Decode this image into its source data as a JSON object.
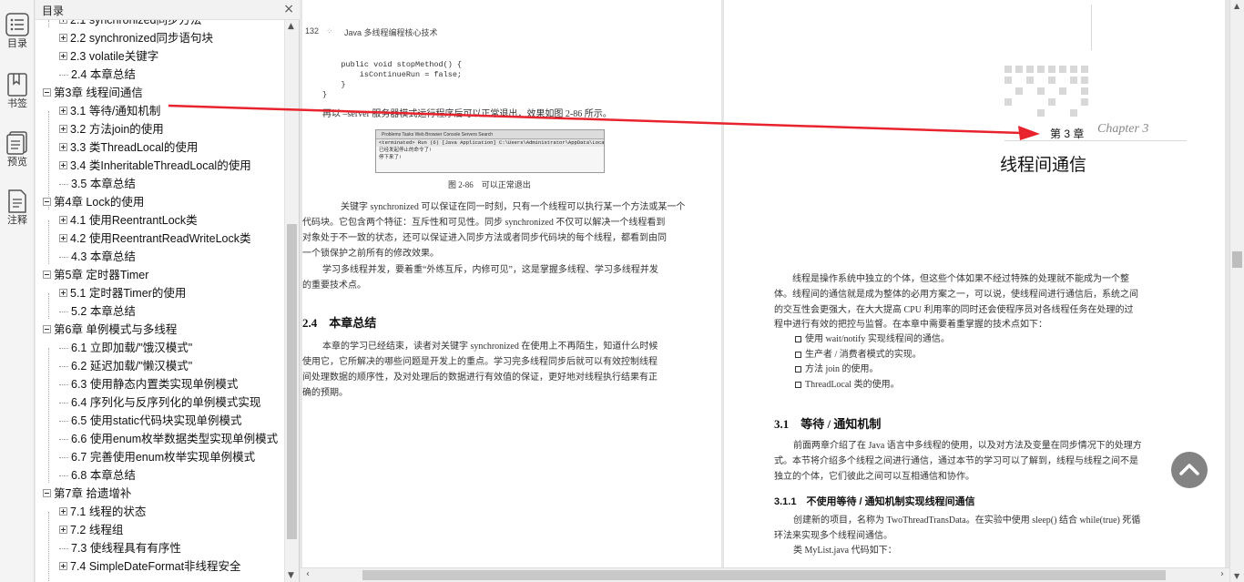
{
  "rail": {
    "items": [
      {
        "label": "目录",
        "icon": "toc-icon"
      },
      {
        "label": "书签",
        "icon": "bookmark-icon"
      },
      {
        "label": "预览",
        "icon": "preview-icon"
      },
      {
        "label": "注释",
        "icon": "annotation-icon"
      }
    ]
  },
  "toc": {
    "title": "目录",
    "close": "×",
    "items": [
      {
        "label": "2.1 synchronized同步方法",
        "level": 2,
        "expand": "plus"
      },
      {
        "label": "2.2 synchronized同步语句块",
        "level": 2,
        "expand": "plus"
      },
      {
        "label": "2.3 volatile关键字",
        "level": 2,
        "expand": "plus"
      },
      {
        "label": "2.4 本章总结",
        "level": 2,
        "expand": "none"
      },
      {
        "label": "第3章 线程间通信",
        "level": 1,
        "expand": "minus"
      },
      {
        "label": "3.1 等待/通知机制",
        "level": 2,
        "expand": "plus"
      },
      {
        "label": "3.2 方法join的使用",
        "level": 2,
        "expand": "plus"
      },
      {
        "label": "3.3 类ThreadLocal的使用",
        "level": 2,
        "expand": "plus"
      },
      {
        "label": "3.4 类InheritableThreadLocal的使用",
        "level": 2,
        "expand": "plus"
      },
      {
        "label": "3.5 本章总结",
        "level": 2,
        "expand": "none"
      },
      {
        "label": "第4章 Lock的使用",
        "level": 1,
        "expand": "minus"
      },
      {
        "label": "4.1 使用ReentrantLock类",
        "level": 2,
        "expand": "plus"
      },
      {
        "label": "4.2 使用ReentrantReadWriteLock类",
        "level": 2,
        "expand": "plus"
      },
      {
        "label": "4.3 本章总结",
        "level": 2,
        "expand": "none"
      },
      {
        "label": "第5章 定时器Timer",
        "level": 1,
        "expand": "minus"
      },
      {
        "label": "5.1 定时器Timer的使用",
        "level": 2,
        "expand": "plus"
      },
      {
        "label": "5.2 本章总结",
        "level": 2,
        "expand": "none"
      },
      {
        "label": "第6章 单例模式与多线程",
        "level": 1,
        "expand": "minus"
      },
      {
        "label": "6.1 立即加载/\"饿汉模式\"",
        "level": 2,
        "expand": "none"
      },
      {
        "label": "6.2 延迟加载/\"懒汉模式\"",
        "level": 2,
        "expand": "none"
      },
      {
        "label": "6.3 使用静态内置类实现单例模式",
        "level": 2,
        "expand": "none"
      },
      {
        "label": "6.4 序列化与反序列化的单例模式实现",
        "level": 2,
        "expand": "none"
      },
      {
        "label": "6.5 使用static代码块实现单例模式",
        "level": 2,
        "expand": "none"
      },
      {
        "label": "6.6 使用enum枚举数据类型实现单例模式",
        "level": 2,
        "expand": "none"
      },
      {
        "label": "6.7 完善使用enum枚举实现单例模式",
        "level": 2,
        "expand": "none"
      },
      {
        "label": "6.8 本章总结",
        "level": 2,
        "expand": "none"
      },
      {
        "label": "第7章 拾遗增补",
        "level": 1,
        "expand": "minus"
      },
      {
        "label": "7.1 线程的状态",
        "level": 2,
        "expand": "plus"
      },
      {
        "label": "7.2 线程组",
        "level": 2,
        "expand": "plus"
      },
      {
        "label": "7.3 使线程具有有序性",
        "level": 2,
        "expand": "none"
      },
      {
        "label": "7.4 SimpleDateFormat非线程安全",
        "level": 2,
        "expand": "plus"
      }
    ]
  },
  "left_page": {
    "header_num": "132",
    "header_title": "Java 多线程编程核心技术",
    "code": "    public void stopMethod() {\n        isContinueRun = false;\n    }\n}",
    "para1": "再以 –server 服务器模式运行程序后可以正常退出，效果如图 2-86 所示。",
    "shot_tabs": "Problems  Tasks  Web Browser  Console  Servers  Search",
    "shot_line1": "<terminated> Run (6) [Java Application] C:\\Users\\Administrator\\AppData\\Local\\",
    "shot_line2": "已经发起停止的命令了!",
    "shot_line3": "停下来了!",
    "fig_caption": "图 2-86　可以正常退出",
    "para2a": "关键字 synchronized 可以保证在同一时刻，只有一个线程可以执行某一个方法或某一个",
    "para2b": "代码块。它包含两个特征：互斥性和可见性。同步 synchronized 不仅可以解决一个线程看到",
    "para2c": "对象处于不一致的状态，还可以保证进入同步方法或者同步代码块的每个线程，都看到由同",
    "para2d": "一个锁保护之前所有的修改效果。",
    "para3a": "学习多线程并发，要着重“外练互斥，内修可见”，这是掌握多线程、学习多线程并发",
    "para3b": "的重要技术点。",
    "section_title": "2.4　本章总结",
    "para4a": "本章的学习已经结束，读者对关键字 synchronized 在使用上不再陌生，知道什么时候",
    "para4b": "使用它，它所解决的哪些问题是开发上的重点。学习完多线程同步后就可以有效控制线程",
    "para4c": "间处理数据的顺序性，及对处理后的数据进行有效值的保证，更好地对线程执行结果有正",
    "para4d": "确的预期。"
  },
  "right_page": {
    "chapter_label": "第 3 章",
    "chapter_script": "Chapter 3",
    "chapter_title": "线程间通信",
    "intro1": "线程是操作系统中独立的个体，但这些个体如果不经过特殊的处理就不能成为一个整",
    "intro2": "体。线程间的通信就是成为整体的必用方案之一，可以说，使线程间进行通信后，系统之间",
    "intro3": "的交互性会更强大，在大大提高 CPU 利用率的同时还会使程序员对各线程任务在处理的过",
    "intro4": "程中进行有效的把控与监督。在本章中需要着重掌握的技术点如下：",
    "bullets": [
      "使用 wait/notify 实现线程间的通信。",
      "生产者 / 消费者模式的实现。",
      "方法 join 的使用。",
      "ThreadLocal 类的使用。"
    ],
    "sec31": "3.1　等待 / 通知机制",
    "sec31_p1": "前面两章介绍了在 Java 语言中多线程的使用，以及对方法及变量在同步情况下的处理方",
    "sec31_p2": "式。本节将介绍多个线程之间进行通信，通过本节的学习可以了解到，线程与线程之间不是",
    "sec31_p3": "独立的个体，它们彼此之间可以互相通信和协作。",
    "sec311": "3.1.1　不使用等待 / 通知机制实现线程间通信",
    "sec311_p1": "创建新的项目，名称为 TwoThreadTransData。在实验中使用 sleep() 结合 while(true) 死循",
    "sec311_p2": "环法来实现多个线程间通信。",
    "sec311_p3": "类 MyList.java 代码如下："
  },
  "colors": {
    "arrow": "#e8232d",
    "selected": "#d6e8fa"
  }
}
